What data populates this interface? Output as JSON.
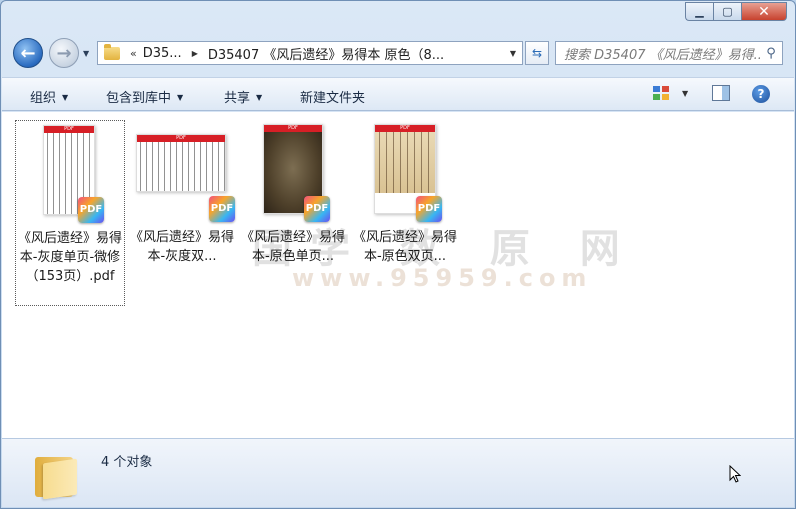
{
  "address": {
    "crumb_1": "D35...",
    "crumb_2": "D35407 《风后遗经》易得本 原色（8..."
  },
  "search": {
    "placeholder": "搜索 D35407 《风后遗经》易得..."
  },
  "toolbar": {
    "organize": "组织",
    "include_in_library": "包含到库中",
    "share": "共享",
    "new_folder": "新建文件夹"
  },
  "files": [
    {
      "label": "《风后遗经》易得本-灰度单页-微修（153页）.pdf",
      "thumb": "text",
      "selected": true
    },
    {
      "label": "《风后遗经》易得本-灰度双...",
      "thumb": "text-wide",
      "selected": false
    },
    {
      "label": "《风后遗经》易得本-原色单页...",
      "thumb": "photo",
      "selected": false
    },
    {
      "label": "《风后遗经》易得本-原色双页...",
      "thumb": "color",
      "selected": false
    }
  ],
  "watermark": {
    "text": "国学 数 原 网",
    "url": "www.95959.com"
  },
  "status": {
    "count": "4 个对象"
  },
  "colors": {
    "accent": "#2a6bc0",
    "pdf_red": "#d71f26",
    "close": "#c7422e"
  },
  "icons": [
    "back-arrow-icon",
    "forward-arrow-icon",
    "folder-icon",
    "refresh-icon",
    "search-icon",
    "view-icon",
    "preview-pane-icon",
    "help-icon",
    "pdf-icon"
  ]
}
